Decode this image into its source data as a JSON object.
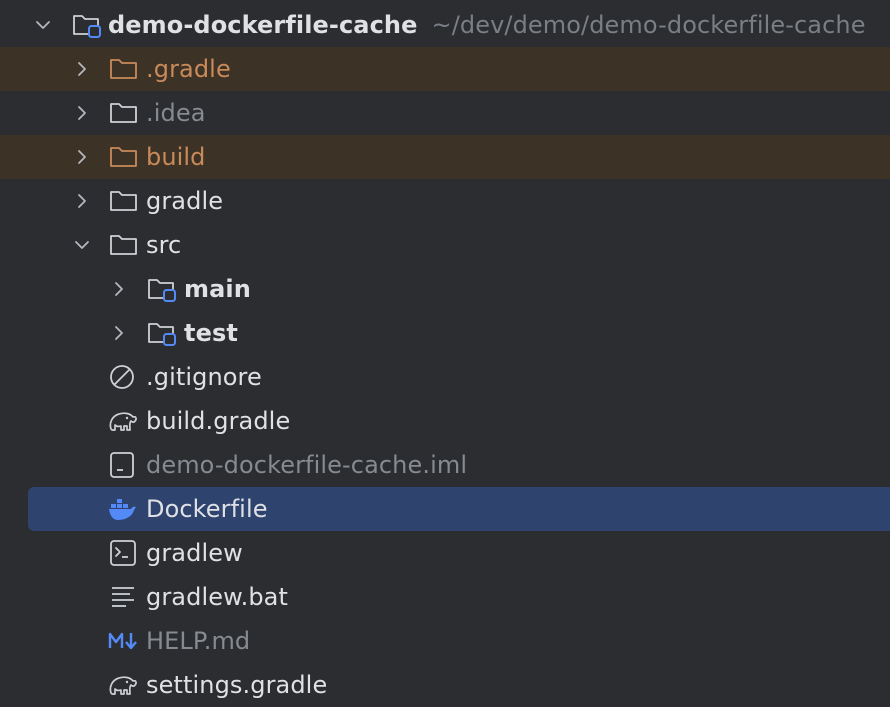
{
  "colors": {
    "background": "#2b2d30",
    "excluded_row": "#3c3226",
    "selected_row": "#2e436e",
    "excluded_text": "#c98a5a",
    "ignored_text": "#868a91",
    "normal_text": "#dfe1e5",
    "accent_blue": "#548af7"
  },
  "tree": {
    "root": {
      "label": "demo-dockerfile-cache",
      "path": "~/dev/demo/demo-dockerfile-cache",
      "icon": "module-folder-icon",
      "expanded": true
    },
    "items": [
      {
        "label": ".gradle",
        "icon": "folder-icon",
        "kind": "folder",
        "state": "excluded",
        "expanded": false
      },
      {
        "label": ".idea",
        "icon": "folder-icon",
        "kind": "folder",
        "state": "ignored",
        "expanded": false
      },
      {
        "label": "build",
        "icon": "folder-icon",
        "kind": "folder",
        "state": "excluded",
        "expanded": false
      },
      {
        "label": "gradle",
        "icon": "folder-icon",
        "kind": "folder",
        "state": "normal",
        "expanded": false
      },
      {
        "label": "src",
        "icon": "folder-icon",
        "kind": "folder",
        "state": "normal",
        "expanded": true
      },
      {
        "label": "main",
        "icon": "module-folder-icon",
        "kind": "folder",
        "state": "module",
        "expanded": false
      },
      {
        "label": "test",
        "icon": "module-folder-icon",
        "kind": "folder",
        "state": "module",
        "expanded": false
      },
      {
        "label": ".gitignore",
        "icon": "ignore-file-icon",
        "kind": "file",
        "state": "normal"
      },
      {
        "label": "build.gradle",
        "icon": "gradle-elephant-icon",
        "kind": "file",
        "state": "normal"
      },
      {
        "label": "demo-dockerfile-cache.iml",
        "icon": "iml-file-icon",
        "kind": "file",
        "state": "ignored"
      },
      {
        "label": "Dockerfile",
        "icon": "docker-whale-icon",
        "kind": "file",
        "state": "selected"
      },
      {
        "label": "gradlew",
        "icon": "terminal-script-icon",
        "kind": "file",
        "state": "normal"
      },
      {
        "label": "gradlew.bat",
        "icon": "text-lines-icon",
        "kind": "file",
        "state": "normal"
      },
      {
        "label": "HELP.md",
        "icon": "markdown-icon",
        "kind": "file",
        "state": "ignored"
      },
      {
        "label": "settings.gradle",
        "icon": "gradle-elephant-icon",
        "kind": "file",
        "state": "normal"
      }
    ]
  }
}
